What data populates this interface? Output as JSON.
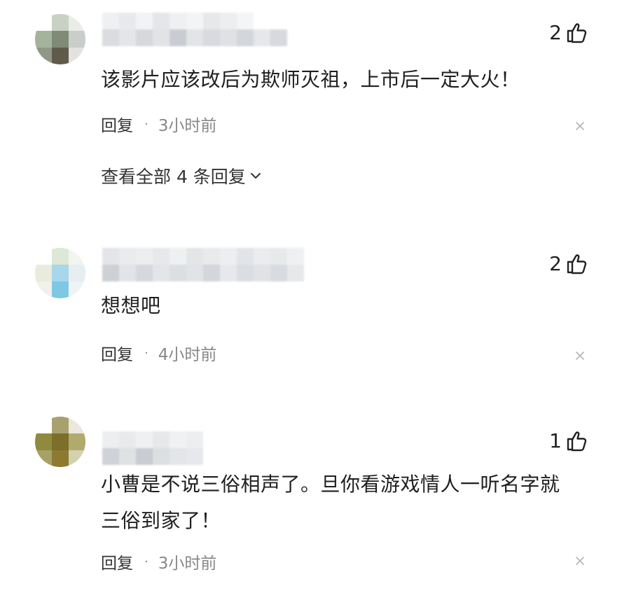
{
  "comments": [
    {
      "likes": "2",
      "text": "该影片应该改后为欺师灭祖，上市后一定大火！",
      "reply_label": "回复",
      "separator": "·",
      "time": "3小时前",
      "view_all": "查看全部 4 条回复",
      "avatar_colors": [
        "#ffffff",
        "#c8d2c4",
        "#e9ede6",
        "#a3b39c",
        "#7f8b76",
        "#c9ceca",
        "#8f9886",
        "#5f5a4c",
        "#e4e2de"
      ]
    },
    {
      "likes": "2",
      "text": "想想吧",
      "reply_label": "回复",
      "separator": "·",
      "time": "4小时前",
      "avatar_colors": [
        "#ffffff",
        "#dde8d6",
        "#f2f5ef",
        "#e9ecdd",
        "#a6d7ea",
        "#e6eef1",
        "#f1f0ea",
        "#7fc8e5",
        "#eef3f5"
      ]
    },
    {
      "likes": "1",
      "text_lines": [
        "小曹是不说三俗相声了。旦你看游戏情人一听名字就",
        "三俗到家了！"
      ],
      "reply_label": "回复",
      "separator": "·",
      "time": "3小时前",
      "avatar_colors": [
        "#ffffff",
        "#a9a070",
        "#eae8dc",
        "#8f8a3e",
        "#7c6f2a",
        "#b0ab6c",
        "#a6a267",
        "#8d7a30",
        "#d4d1b0"
      ]
    }
  ],
  "icons": {
    "like": "thumbs-up-icon",
    "close": "close-icon",
    "expand": "chevron-down-icon"
  },
  "colors": {
    "text": "#1f1f1f",
    "meta": "#888888",
    "blurred_name": "#d9d9dc"
  }
}
